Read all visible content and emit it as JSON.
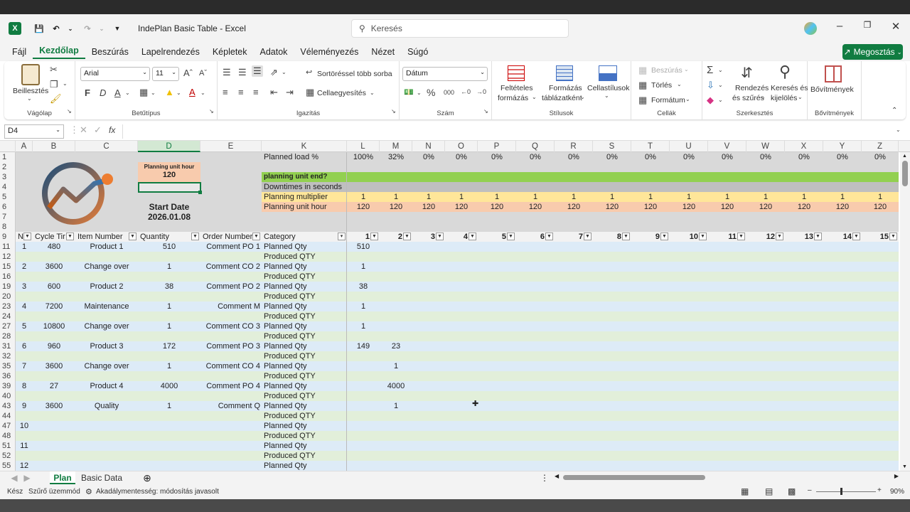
{
  "app": {
    "file_title": "IndePlan Basic Table",
    "sep": "-",
    "app_name": "Excel",
    "search_placeholder": "Keresés"
  },
  "menu": {
    "items": [
      "Fájl",
      "Kezdőlap",
      "Beszúrás",
      "Lapelrendezés",
      "Képletek",
      "Adatok",
      "Véleményezés",
      "Nézet",
      "Súgó"
    ],
    "share": "Megosztás"
  },
  "ribbon": {
    "vagolap": {
      "paste": "Beillesztés",
      "group": "Vágólap"
    },
    "betutipus": {
      "font": "Arial",
      "size": "11",
      "group": "Betűtípus"
    },
    "igazitas": {
      "wrap": "Sortöréssel több sorba",
      "merge": "Cellaegyesítés",
      "group": "Igazítás"
    },
    "szam": {
      "format": "Dátum",
      "group": "Szám"
    },
    "stilusok": {
      "cond1": "Feltételes",
      "cond2": "formázás",
      "tbl1": "Formázás",
      "tbl2": "táblázatként",
      "cell1": "Cellastílusok",
      "group": "Stílusok"
    },
    "cellak": {
      "insert": "Beszúrás",
      "delete": "Törlés",
      "format": "Formátum",
      "group": "Cellák"
    },
    "szerk": {
      "sort1": "Rendezés",
      "sort2": "és szűrés",
      "find1": "Keresés és",
      "find2": "kijelölés",
      "group": "Szerkesztés"
    },
    "bov": {
      "addins": "Bővítmények",
      "group": "Bővítmények"
    }
  },
  "formula": {
    "namebox": "D4",
    "fx": "fx",
    "content": ""
  },
  "columns": [
    "A",
    "B",
    "C",
    "D",
    "E",
    "K",
    "L",
    "M",
    "N",
    "O",
    "P",
    "Q",
    "R",
    "S",
    "T",
    "U",
    "V",
    "W",
    "X",
    "Y",
    "Z"
  ],
  "header_block": {
    "puh_label": "Planning unit hour",
    "puh_value": "120",
    "start_label": "Start Date",
    "start_value": "2026.01.08",
    "planned_load": "Planned load %",
    "load_values": [
      "100%",
      "32%",
      "0%",
      "0%",
      "0%",
      "0%",
      "0%",
      "0%",
      "0%",
      "0%",
      "0%",
      "0%",
      "0%",
      "0%",
      "0%"
    ],
    "unit_end": "planning unit end?",
    "downtimes": "Downtimes in seconds",
    "multiplier": "Planning multiplier",
    "multiplier_value": "1",
    "unit_hour": "Planning unit hour",
    "unit_hour_value": "120"
  },
  "table_headers": {
    "n": "N",
    "cycle": "Cycle Tir",
    "item": "Item Number",
    "qty": "Quantity",
    "order": "Order Number",
    "cat": "Category",
    "periods": [
      "1",
      "2",
      "3",
      "4",
      "5",
      "6",
      "7",
      "8",
      "9",
      "10",
      "11",
      "12",
      "13",
      "14",
      "15"
    ]
  },
  "rows": [
    {
      "r1": "11",
      "r2": "12",
      "n": "1",
      "cycle": "480",
      "item": "Product 1",
      "qty": "510",
      "order": "Comment PO 1",
      "L": "510",
      "M": ""
    },
    {
      "r1": "15",
      "r2": "16",
      "n": "2",
      "cycle": "3600",
      "item": "Change over",
      "qty": "1",
      "order": "Comment CO 2",
      "L": "1",
      "M": ""
    },
    {
      "r1": "19",
      "r2": "20",
      "n": "3",
      "cycle": "600",
      "item": "Product 2",
      "qty": "38",
      "order": "Comment PO 2",
      "L": "38",
      "M": ""
    },
    {
      "r1": "23",
      "r2": "24",
      "n": "4",
      "cycle": "7200",
      "item": "Maintenance",
      "qty": "1",
      "order": "Comment M",
      "L": "1",
      "M": ""
    },
    {
      "r1": "27",
      "r2": "28",
      "n": "5",
      "cycle": "10800",
      "item": "Change over",
      "qty": "1",
      "order": "Comment CO 3",
      "L": "1",
      "M": ""
    },
    {
      "r1": "31",
      "r2": "32",
      "n": "6",
      "cycle": "960",
      "item": "Product 3",
      "qty": "172",
      "order": "Comment PO 3",
      "L": "149",
      "M": "23"
    },
    {
      "r1": "35",
      "r2": "36",
      "n": "7",
      "cycle": "3600",
      "item": "Change over",
      "qty": "1",
      "order": "Comment CO 4",
      "L": "",
      "M": "1"
    },
    {
      "r1": "39",
      "r2": "40",
      "n": "8",
      "cycle": "27",
      "item": "Product 4",
      "qty": "4000",
      "order": "Comment PO 4",
      "L": "",
      "M": "4000"
    },
    {
      "r1": "43",
      "r2": "44",
      "n": "9",
      "cycle": "3600",
      "item": "Quality",
      "qty": "1",
      "order": "Comment Q",
      "L": "",
      "M": "1"
    },
    {
      "r1": "47",
      "r2": "48",
      "n": "10",
      "cycle": "",
      "item": "",
      "qty": "",
      "order": "",
      "L": "",
      "M": ""
    },
    {
      "r1": "51",
      "r2": "52",
      "n": "11",
      "cycle": "",
      "item": "",
      "qty": "",
      "order": "",
      "L": "",
      "M": ""
    },
    {
      "r1": "55",
      "r2": "",
      "n": "12",
      "cycle": "",
      "item": "",
      "qty": "",
      "order": "",
      "L": "",
      "M": ""
    }
  ],
  "categories": {
    "planned": "Planned Qty",
    "produced": "Produced QTY"
  },
  "sheets": [
    "Plan",
    "Basic Data"
  ],
  "status": {
    "ready": "Kész",
    "filter": "Szűrő üzemmód",
    "access": "Akadálymentesség: módosítás javasolt",
    "zoom": "90%"
  },
  "colors": {
    "green": "#107c41",
    "header_orange": "#f8cbad",
    "green_bar": "#92d050",
    "gray_bar": "#bfbfbf",
    "yellow": "#ffe699",
    "peach": "#f8cbad",
    "blue_row": "#ddebf7",
    "green_row": "#e2efda",
    "top_gray": "#d9d9d9"
  }
}
